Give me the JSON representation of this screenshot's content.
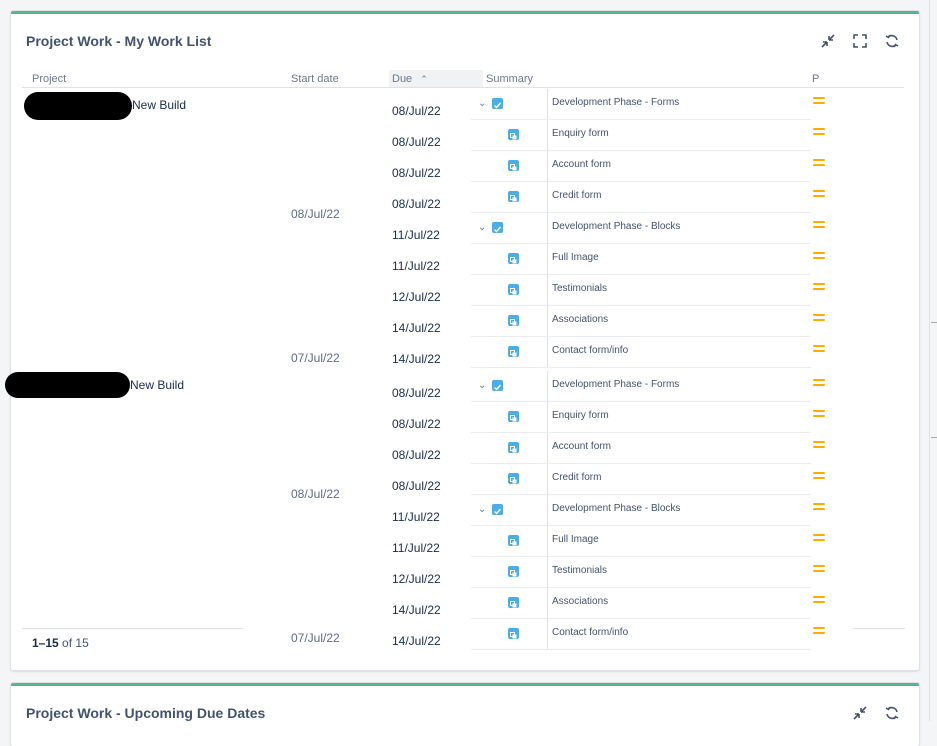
{
  "gadget1": {
    "title": "Project Work - My Work List",
    "tools": [
      "minimize-icon",
      "fullscreen-icon",
      "refresh-icon"
    ],
    "columns": {
      "project": "Project",
      "start": "Start date",
      "due": "Due",
      "summary": "Summary",
      "priority": "P"
    },
    "groups": [
      {
        "project_label": "New Build"
      },
      {
        "project_label": "New Build"
      }
    ],
    "start_dates": [
      "08/Jul/22",
      "07/Jul/22",
      "08/Jul/22",
      "07/Jul/22"
    ],
    "rows": [
      {
        "due": "08/Jul/22",
        "summary": "Development Phase - Forms",
        "type": "parent"
      },
      {
        "due": "08/Jul/22",
        "summary": "Enquiry form",
        "type": "sub"
      },
      {
        "due": "08/Jul/22",
        "summary": "Account form",
        "type": "sub"
      },
      {
        "due": "08/Jul/22",
        "summary": "Credit form",
        "type": "sub"
      },
      {
        "due": "11/Jul/22",
        "summary": "Development Phase - Blocks",
        "type": "parent"
      },
      {
        "due": "11/Jul/22",
        "summary": "Full Image",
        "type": "sub"
      },
      {
        "due": "12/Jul/22",
        "summary": "Testimonials",
        "type": "sub"
      },
      {
        "due": "14/Jul/22",
        "summary": "Associations",
        "type": "sub"
      },
      {
        "due": "14/Jul/22",
        "summary": "Contact form/info",
        "type": "sub"
      },
      {
        "due": "08/Jul/22",
        "summary": "Development Phase - Forms",
        "type": "parent"
      },
      {
        "due": "08/Jul/22",
        "summary": "Enquiry form",
        "type": "sub"
      },
      {
        "due": "08/Jul/22",
        "summary": "Account form",
        "type": "sub"
      },
      {
        "due": "08/Jul/22",
        "summary": "Credit form",
        "type": "sub"
      },
      {
        "due": "11/Jul/22",
        "summary": "Development Phase - Blocks",
        "type": "parent"
      },
      {
        "due": "11/Jul/22",
        "summary": "Full Image",
        "type": "sub"
      },
      {
        "due": "12/Jul/22",
        "summary": "Testimonials",
        "type": "sub"
      },
      {
        "due": "14/Jul/22",
        "summary": "Associations",
        "type": "sub"
      },
      {
        "due": "14/Jul/22",
        "summary": "Contact form/info",
        "type": "sub"
      }
    ],
    "pager": {
      "range": "1–15",
      "of": "of",
      "total": "15"
    },
    "priority_color": "#ffab00",
    "accent": "#57b58a"
  },
  "gadget2": {
    "title": "Project Work - Upcoming Due Dates",
    "tools": [
      "minimize-icon",
      "refresh-icon"
    ]
  }
}
